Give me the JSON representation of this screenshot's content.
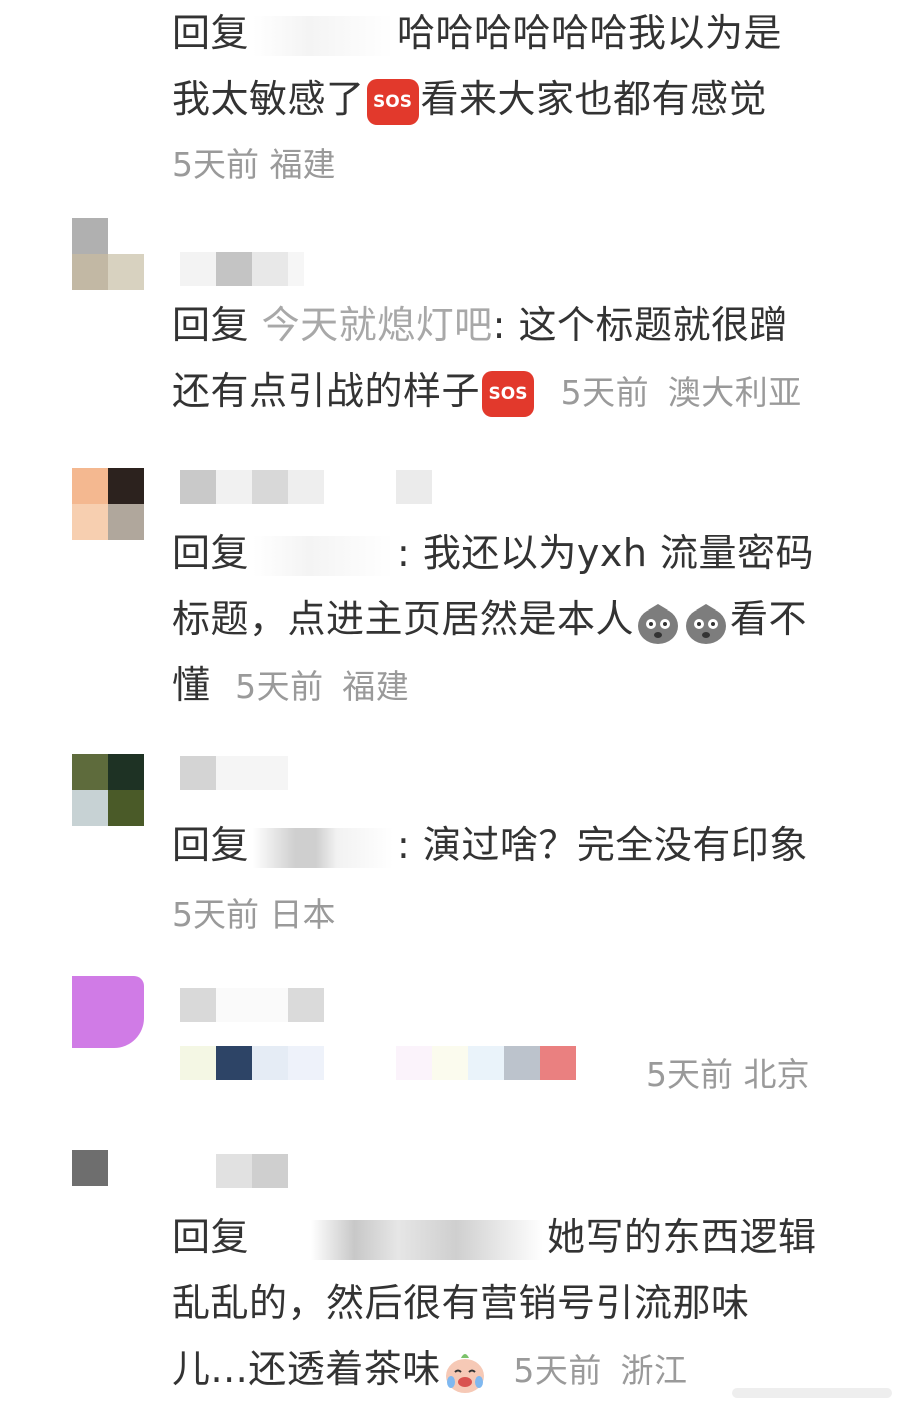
{
  "comments": [
    {
      "reply_label": "回复",
      "reply_target": "",
      "text_line1": "哈哈哈哈哈哈我以为是",
      "text_line2a": "我太敏感了",
      "emoji1": "SOS",
      "text_line2b": "看来大家也都有感觉",
      "time": "5天前",
      "location": "福建"
    },
    {
      "reply_label": "回复",
      "reply_target": "今天就熄灯吧",
      "text_line1": ": 这个标题就很蹭",
      "text_line2a": "还有点引战的样子",
      "emoji1": "SOS",
      "time": "5天前",
      "location": "澳大利亚"
    },
    {
      "reply_label": "回复",
      "reply_target": "",
      "text_line1": ": 我还以为yxh 流量密码",
      "text_line2a": "标题，点进主页居然是本人",
      "emoji_icon": "shocked-blob-icon",
      "text_line2b": "看不",
      "text_line3": "懂",
      "time": "5天前",
      "location": "福建"
    },
    {
      "reply_label": "回复",
      "reply_target": "",
      "text_line1": ": 演过啥？完全没有印象",
      "time": "5天前",
      "location": "日本"
    },
    {
      "time": "5天前",
      "location": "北京"
    },
    {
      "reply_label": "回复",
      "reply_target": "",
      "text_line1": "她写的东西逻辑",
      "text_line2a": "乱乱的，然后很有营销号引流那味",
      "text_line3": "儿...还透着茶味",
      "emoji_icon": "crying-laughing-icon",
      "time": "5天前",
      "location": "浙江"
    }
  ],
  "colors": {
    "text": "#333333",
    "meta": "#9a9a9a",
    "reply_target": "#a8a8a8",
    "sos": "#e2392c"
  }
}
